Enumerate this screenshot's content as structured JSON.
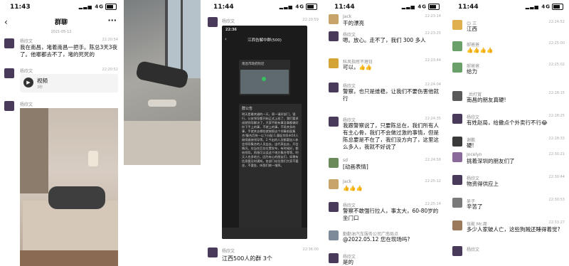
{
  "panel1": {
    "time": "11:43",
    "network": "4G",
    "title": "群聊",
    "back_icon": "chevron-left-icon",
    "more_icon": "ellipsis-icon",
    "date": "2021-05-12",
    "msg1": {
      "sender": "杨欣文",
      "time": "22:20:54",
      "text": "我在南昌，堵着南昌一把手。陈总3天3夜了。他哪都去不了，堵的死死的"
    },
    "msg2": {
      "sender": "杨欣文",
      "time": "22:20:52",
      "card_title": "视频",
      "card_sub": "3秒"
    },
    "msg3": {
      "sender": "杨欣文"
    }
  },
  "panel3": {
    "time": "11:44",
    "network": "4G",
    "sender_top": "杨欣文",
    "ts_top": "22:20:59",
    "inner_time": "22:36",
    "inner_title": "江西告解中群(500)",
    "inner_location": "南昌市政府附近",
    "notice_title": "群公告",
    "notice_text": "明天是最关键的一天，周一请好部门，银行，公安领导都开始正式上班了，我们要求成就领导解决了，大家不能有事没事都做好你下手上的事，不就上的事，不再关多的事，手就关去哪些就按照这个领事前面集合!集合后统一以下分配:1.督促领导市50人继续维修领导等。2.今出的人员都要加人参会领导集合的人员出去，出代表出去，开会情况，应当在后台位置发布，有时候好，都给领导，再指可以设这个地方集合等等。明天人也多地方，因为有心的朋友们，如果有信息要及时通知。各部门站位我们大家不要坐，不要坐，听我们统一指挥。",
    "bottom_sender": "杨欣文",
    "bottom_time": "22:36:00",
    "bottom_text": "江西500人的群 3个"
  },
  "panel4": {
    "time": "11:44",
    "network": "4G",
    "messages": [
      {
        "sender": "Jack",
        "time": "22:23:14",
        "text": "干的漂亮"
      },
      {
        "sender": "杨欣文",
        "time": "22:23:25",
        "text": "嗯。放心。走不了，我们 300 多人"
      },
      {
        "sender": "科风指挥不理日",
        "time": "22:23:44",
        "text": "可以，👍👍"
      },
      {
        "sender": "杨欣文",
        "time": "22:24:04",
        "text": "警察，也只是维稳，让我们不要伤害他就行"
      },
      {
        "sender": "杨欣文",
        "time": "22:24:35",
        "text": "我跟警察说了，只要陈总在，我们所有人有主心骨，我们不会做过激的事情，但是陈总要是不在了，我们没方向了，这里这么多人，我就不好说了"
      },
      {
        "sender": "sd",
        "time": "22:24:58",
        "text": "[动画表情]"
      },
      {
        "sender": "Jack",
        "time": "22:25:12",
        "text": "👍👍👍"
      },
      {
        "sender": "杨欣文",
        "time": "22:25:14",
        "text": "警察不敢强行拉人，事太大，60-80岁的坐门口"
      },
      {
        "sender": "勤勤油汽车服务公司广南局点",
        "time": "",
        "text": "@2022.05.12 您在现场吗?"
      },
      {
        "sender": "杨欣文",
        "time": "",
        "text": "是的"
      }
    ]
  },
  "panel5": {
    "time": "11:44",
    "network": "4G",
    "messages": [
      {
        "sender": "😊 三",
        "time": "22:24:52",
        "text": "江西"
      },
      {
        "sender": "郝爸爸",
        "time": "22:25:00",
        "text": "👍👍👍👍"
      },
      {
        "sender": "郝爸爸",
        "time": "22:25:02",
        "text": "给力"
      },
      {
        "sender": "_后打賞",
        "time": "22:28:15",
        "text": "南昌的朋友真硬!"
      },
      {
        "sender": "杨欣文",
        "time": "22:28:25",
        "text": "有姓赵局，给撒点个外卖行不行😂"
      },
      {
        "sender": "谢鹏",
        "time": "22:28:33",
        "text": "硬!"
      },
      {
        "sender": "Jocelyn",
        "time": "22:30:21",
        "text": "挑着深圳的朋友们了"
      },
      {
        "sender": "杨欣文",
        "time": "22:30:44",
        "text": "物资得供应上"
      },
      {
        "sender": "吴子",
        "time": "22:30:53",
        "text": "辛苦了"
      },
      {
        "sender": "伍能 Mr.周",
        "time": "22:33:27",
        "text": "多少人家破人亡，这些狗贼还睡得着觉?"
      },
      {
        "sender": "杨欣文",
        "time": "",
        "text": ""
      }
    ]
  }
}
